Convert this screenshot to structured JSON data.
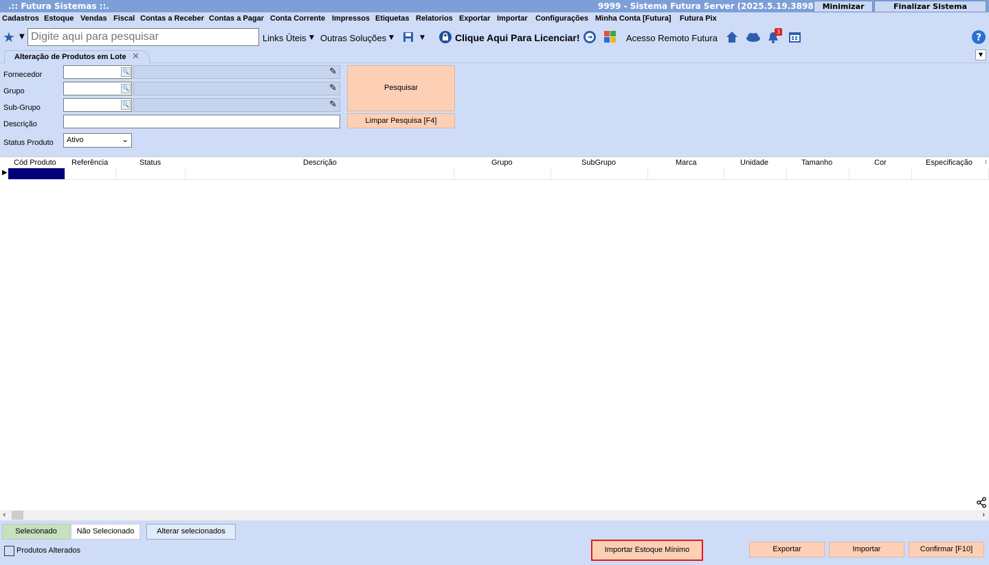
{
  "titlebar": {
    "left": ".:: Futura Sistemas ::.",
    "right": "9999 - Sistema Futura Server (2025.5.19.3898)",
    "minimize": "Minimizar",
    "finalize": "Finalizar Sistema"
  },
  "menu": [
    "Cadastros",
    "Estoque",
    "Vendas",
    "Fiscal",
    "Contas a Receber",
    "Contas a Pagar",
    "Conta Corrente",
    "Impressos",
    "Etiquetas",
    "Relatorios",
    "Exportar",
    "Importar",
    "Configurações",
    "Minha Conta [Futura]",
    "Futura Pix"
  ],
  "toolbar": {
    "search_placeholder": "Digite aqui para pesquisar",
    "links": "Links Úteis",
    "outras": "Outras Soluções",
    "licenciar": "Clique Aqui Para Licenciar!",
    "acesso": "Acesso Remoto Futura",
    "notif_count": "3"
  },
  "tab": {
    "label": "Alteração de Produtos em Lote",
    "close": "✕"
  },
  "filters": {
    "fornecedor": "Fornecedor",
    "grupo": "Grupo",
    "subgrupo": "Sub-Grupo",
    "descricao": "Descrição",
    "status": "Status Produto",
    "status_value": "Ativo",
    "pesquisar": "Pesquisar",
    "limpar": "Limpar Pesquisa [F4]"
  },
  "grid": {
    "columns": [
      "Cód Produto",
      "Referência",
      "Status",
      "Descrição",
      "Grupo",
      "SubGrupo",
      "Marca",
      "Unidade",
      "Tamanho",
      "Cor",
      "Especificação"
    ]
  },
  "bottom": {
    "selecionado": "Selecionado",
    "nao_selecionado": "Não Selecionado",
    "alterar": "Alterar selecionados",
    "produtos_alterados": "Produtos Alterados",
    "importar_estoque": "Importar Estoque Mínimo",
    "exportar": "Exportar",
    "importar": "Importar",
    "confirmar": "Confirmar [F10]"
  }
}
